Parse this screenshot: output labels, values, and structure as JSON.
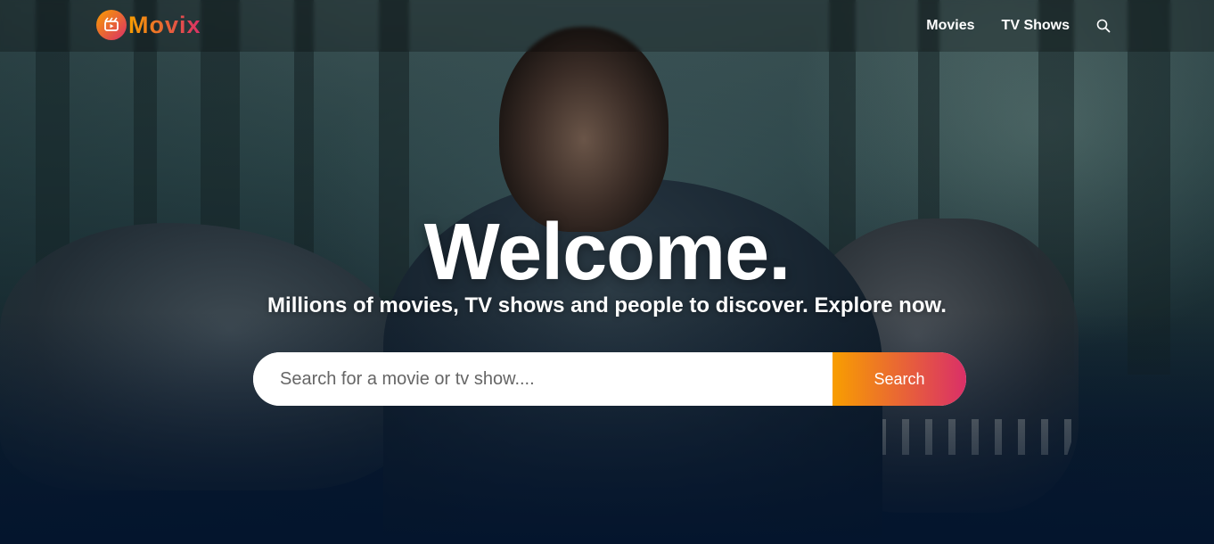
{
  "brand": {
    "name": "Movix",
    "accent_start": "#f89e00",
    "accent_end": "#da2f68"
  },
  "nav": {
    "items": [
      {
        "label": "Movies"
      },
      {
        "label": "TV Shows"
      }
    ],
    "search_icon": "search-icon"
  },
  "hero": {
    "title": "Welcome.",
    "subtitle": "Millions of movies, TV shows and people to discover. Explore now.",
    "background_color": "#04152d"
  },
  "search": {
    "placeholder": "Search for a movie or tv show....",
    "value": "",
    "button_label": "Search"
  }
}
